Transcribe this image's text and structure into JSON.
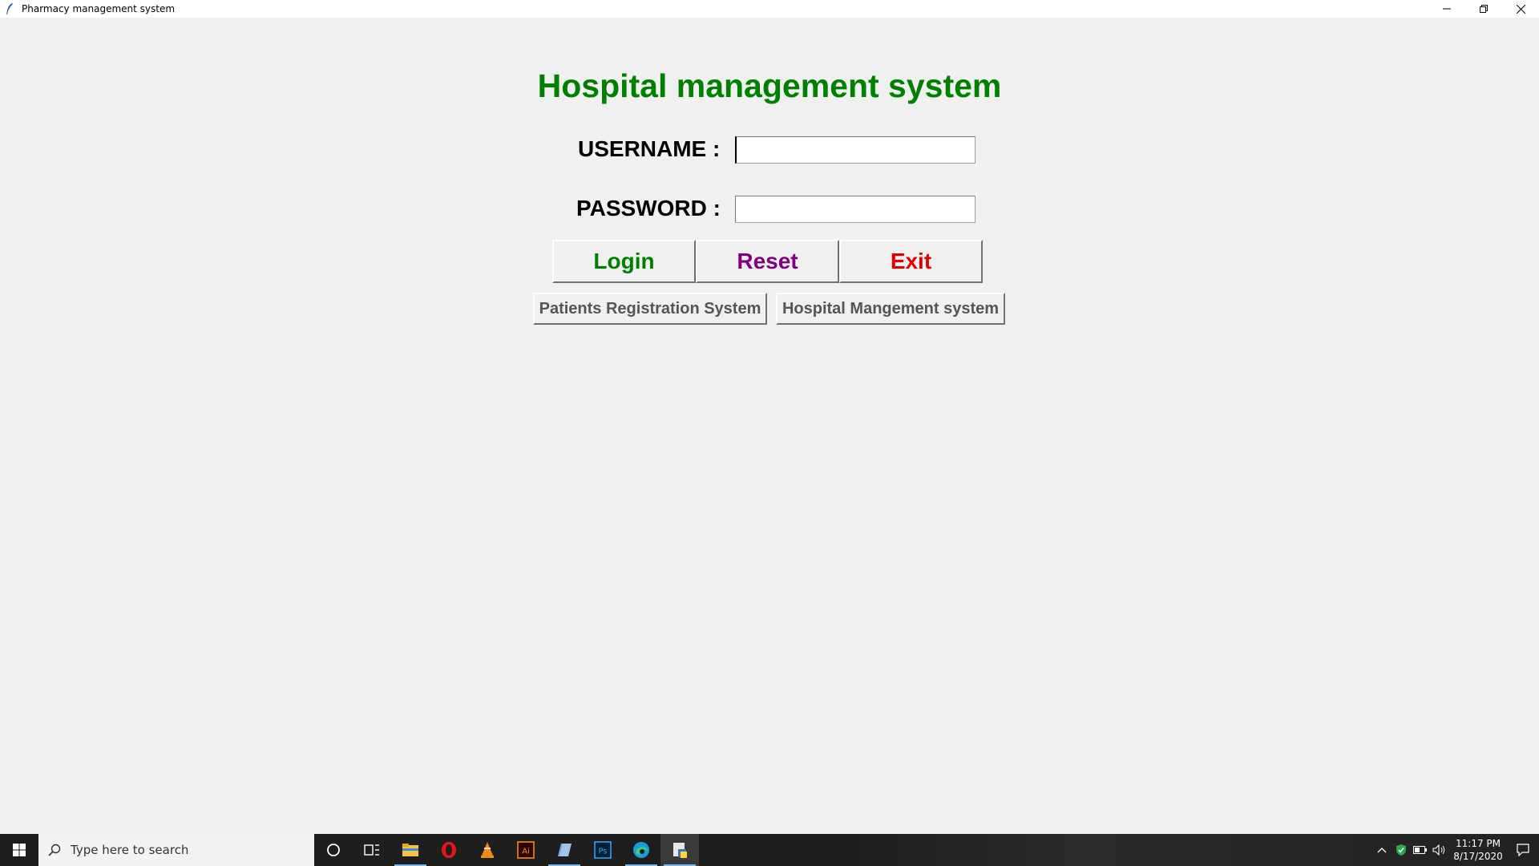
{
  "window": {
    "title": "Pharmacy management system",
    "icon": "feather-icon",
    "controls": [
      "minimize-icon",
      "restore-icon",
      "close-icon"
    ]
  },
  "form": {
    "heading": "Hospital management system",
    "username_label": "USERNAME :",
    "username_value": "",
    "password_label": "PASSWORD :",
    "password_value": "",
    "buttons": {
      "login": "Login",
      "reset": "Reset",
      "exit": "Exit",
      "patients": "Patients Registration System",
      "hospital": "Hospital Mangement system"
    }
  },
  "colors": {
    "heading": "#008000",
    "login": "#008000",
    "reset": "#800080",
    "exit": "#e00000",
    "secondary_buttons": "#555555",
    "background": "#f0f0f0"
  },
  "taskbar": {
    "search_placeholder": "Type here to search",
    "apps": [
      "cortana-icon",
      "task-view-icon",
      "file-explorer-icon",
      "opera-icon",
      "vlc-icon",
      "illustrator-icon",
      "notes-icon",
      "photoshop-icon",
      "edge-icon",
      "python-app-icon"
    ],
    "tray": [
      "chevron-up-icon",
      "defender-icon",
      "battery-icon",
      "volume-icon"
    ],
    "time": "11:17 PM",
    "date": "8/17/2020"
  }
}
